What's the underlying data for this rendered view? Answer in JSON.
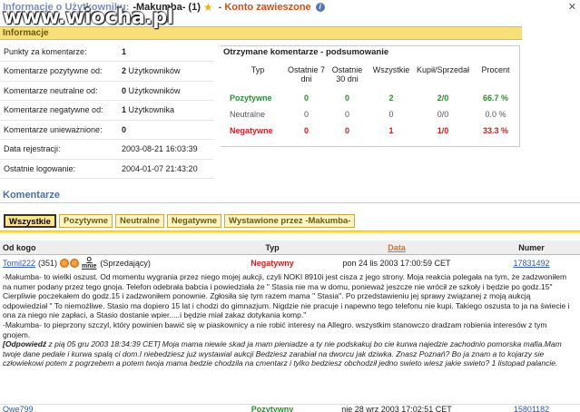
{
  "header": {
    "title_prefix": "Informacje o Użytkowniku:",
    "username": "-Makumba-",
    "rating_count": "(1)",
    "star_icon": "star-icon",
    "dash": "-",
    "suspended": "Konto zawieszone",
    "info_icon": "i",
    "close_icon": "✕"
  },
  "watermark": "www.wiocha.pl",
  "info_section": {
    "title": "Informacje",
    "rows": [
      {
        "label": "Punkty za komentarze:",
        "value": "1",
        "extra": ""
      },
      {
        "label": "Komentarze pozytywne od:",
        "value": "2",
        "extra": "Użytkowników"
      },
      {
        "label": "Komentarze neutralne od:",
        "value": "0",
        "extra": "Użytkowników"
      },
      {
        "label": "Komentarze negatywne od:",
        "value": "1",
        "extra": "Użytkownika"
      },
      {
        "label": "Komentarze unieważnione:",
        "value": "0",
        "extra": ""
      },
      {
        "label": "Data rejestracji:",
        "value": "2003-08-21 16:03:39",
        "extra": ""
      },
      {
        "label": "Ostatnie logowanie:",
        "value": "2004-01-07 21:43:20",
        "extra": ""
      }
    ]
  },
  "summary": {
    "title": "Otrzymane komentarze - podsumowanie",
    "headers": [
      "Typ",
      "Ostatnie 7 dni",
      "Ostatnie 30 dni",
      "Wszystkie",
      "Kupił/Sprzedał",
      "Procent"
    ],
    "rows": [
      {
        "type": "Pozytywne",
        "d7": "0",
        "d30": "0",
        "all": "2",
        "ks": "2/0",
        "pct": "66.7 %"
      },
      {
        "type": "Neutralne",
        "d7": "0",
        "d30": "0",
        "all": "0",
        "ks": "0/0",
        "pct": "0.0 %"
      },
      {
        "type": "Negatywne",
        "d7": "0",
        "d30": "0",
        "all": "1",
        "ks": "1/0",
        "pct": "33.3 %"
      }
    ]
  },
  "comments": {
    "title": "Komentarze",
    "tabs": [
      "Wszystkie",
      "Pozytywne",
      "Neutralne",
      "Negatywne",
      "Wystawione przez -Makumba-"
    ],
    "columns": {
      "from": "Od kogo",
      "type": "Typ",
      "date": "Data",
      "number": "Numer"
    },
    "row1": {
      "user": "Tomil222",
      "points": "(351)",
      "me_label": "mnie",
      "role": "(Sprzedający)",
      "type": "Negatywny",
      "date": "pon 24 lis 2003 17:00:59 CET",
      "number": "17831492"
    },
    "row1_text": [
      "-Makumba- to wielki oszust. Od momentu wygrania przez niego mojej aukcji, czyli NOKI 8910i jest cisza z jego strony. Moja reakcia polegała na tym, że zadzwoniłem na numer podany przez tego gnoja. Telefon odebrała babcia i powiedziała że \" Stasia nie ma w domu, ponieważ jeszcze nie wrócił ze szkoły i będzie po godz.15\" Cierpliwie poczekałem do godz.15 i zadzwoniłem ponownie. Zgłosiła się tym razem mama \" Stasia\". Po przedstawieniu jej sprawy związanej z moją aukcją odpowiedział \" To niemożliwe. Stasio ma dopiero 15 lat i chodzi do gimnazjum. Nigdzie nie pracuje i napewno tego telefonu nie kupi. Takiego oszusta to ja na świecie i ona za niego nie zapłaci, a Stasio dostanie wpier.....i będzie miał zakaz dotykania komp.\"",
      "-Makumba- to pieprzony szczyl, który powinien bawić się w piaskownicy a nie robić interesy na Allegro. wszystkim stanowczo dradzam robienia interesów z tym gnojem."
    ],
    "reply_label": "[Odpowiedź",
    "reply_meta": "z pią 05 gru 2003 18:34:39 CET]",
    "reply_text": "Moja mama niewie skad ja mam pieniadze a ty nie podskakuj bo cie kurwa najedzie zachodnio pomorska mafia.Mam twoje dane pedale i kurwa spalą ci dom.I niebedziesz już wystawial aukcji Bedziesz zarabiał na dworcu jak dziwka. Znasz Poznań? Bo ja znam a to kojarzy sie człowiekowi potem z pogrzebem a potem twoja mama bedzie chodzila na cmentarz i tylko bedziesz obchodził jedno swieto wiesz jakie swieto? 1 listopad palancie.",
    "row2": {
      "user": "Qwe799",
      "type": "Pozytywny",
      "date": "nie 28 wrz 2003 17:02:51 CET",
      "number": "15801182"
    }
  }
}
